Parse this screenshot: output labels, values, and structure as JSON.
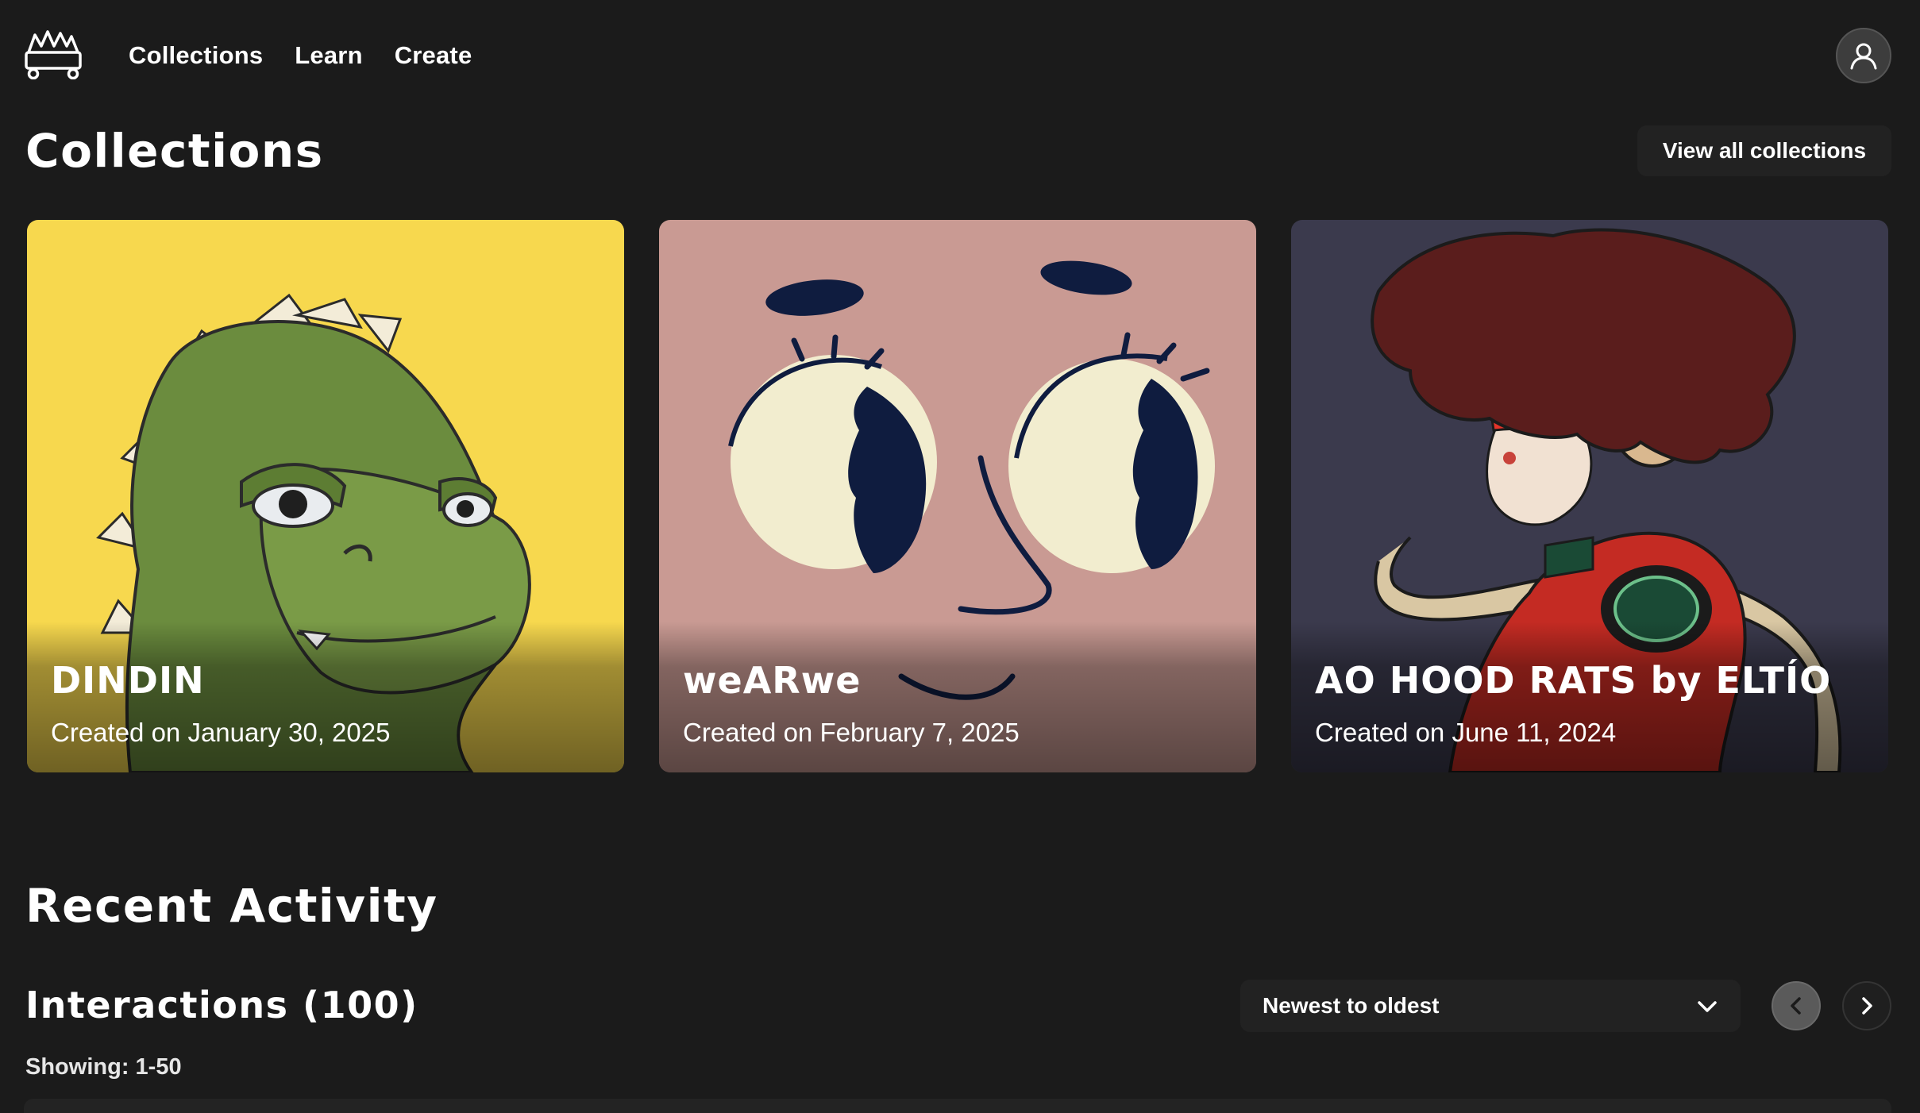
{
  "nav": {
    "logo_icon": "crown-cart-logo-icon",
    "links": [
      "Collections",
      "Learn",
      "Create"
    ],
    "profile_icon": "user-icon"
  },
  "collections": {
    "heading": "Collections",
    "view_all_label": "View all collections",
    "cards": [
      {
        "title": "DINDIN",
        "date": "Created on January 30, 2025",
        "bg_color": "#f7d84e"
      },
      {
        "title": "weARwe",
        "date": "Created on February 7, 2025",
        "bg_color": "#c99a93"
      },
      {
        "title": "AO HOOD RATS by ELTÍO",
        "date": "Created on June 11, 2024",
        "bg_color": "#3b3a4d"
      }
    ]
  },
  "recent_activity": {
    "heading": "Recent Activity",
    "interactions_label": "Interactions (100)",
    "showing_label": "Showing: 1-50",
    "sort": {
      "selected": "Newest to oldest",
      "icon": "chevron-down-icon"
    },
    "pagination": {
      "prev_icon": "chevron-left-icon",
      "next_icon": "chevron-right-icon"
    }
  },
  "colors": {
    "background": "#1b1b1b",
    "surface": "#222222",
    "text": "#ffffff"
  }
}
